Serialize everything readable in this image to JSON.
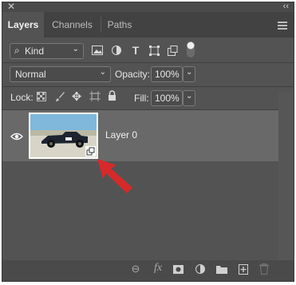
{
  "panel": {
    "tabs": [
      "Layers",
      "Channels",
      "Paths"
    ]
  },
  "filters": {
    "kind_label": "Kind",
    "filter_icons": [
      "image-filter-icon",
      "adjustment-filter-icon",
      "type-filter-icon",
      "shape-filter-icon",
      "smart-object-filter-icon",
      "filter-toggle-icon"
    ]
  },
  "blend": {
    "mode": "Normal",
    "opacity_label": "Opacity:",
    "opacity_value": "100%"
  },
  "lock": {
    "label": "Lock:",
    "fill_label": "Fill:",
    "fill_value": "100%"
  },
  "layers": [
    {
      "name": "Layer 0",
      "visible": true,
      "smart_object": true
    }
  ],
  "annotation": {
    "arrow_color": "#d62a2a"
  },
  "bottom_icons": [
    "link-icon",
    "fx-icon",
    "mask-icon",
    "adjustment-icon",
    "group-folder-icon",
    "new-layer-icon",
    "trash-icon"
  ],
  "bottom": {
    "fx_label": "fx"
  },
  "colors": {
    "panel": "#535353",
    "selected_row": "#696969",
    "text": "#e6e6e6"
  }
}
